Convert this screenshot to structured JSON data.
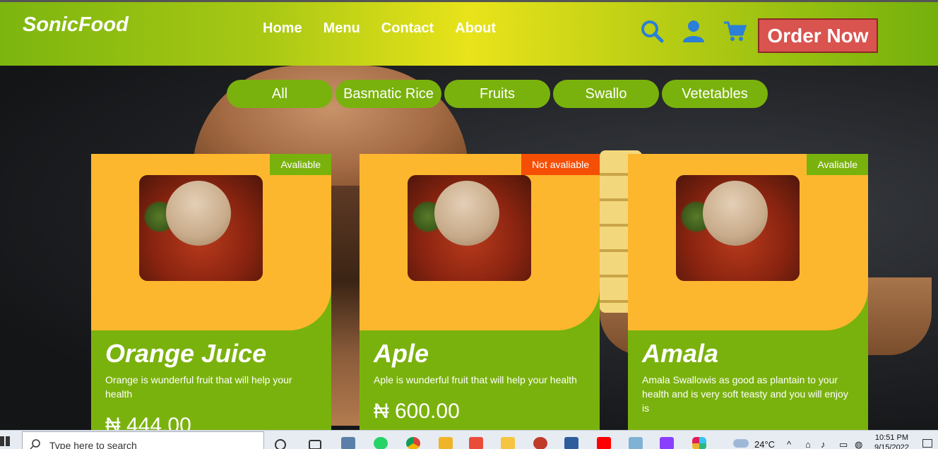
{
  "header": {
    "logo": "SonicFood",
    "nav": [
      "Home",
      "Menu",
      "Contact",
      "About"
    ],
    "icons": [
      "search-icon",
      "user-icon",
      "cart-icon"
    ],
    "order_button": "Order Now"
  },
  "filters": [
    "All",
    "Basmatic Rice",
    "Fruits",
    "Swallo",
    "Vetetables"
  ],
  "cards": [
    {
      "badge": "Avaliable",
      "title": "Orange Juice",
      "description": "Orange is wunderful fruit that will help your health",
      "price": "₦ 444.00"
    },
    {
      "badge": "Not avaliable",
      "title": "Aple",
      "description": "Aple is wunderful fruit that will help your health",
      "price": "₦ 600.00"
    },
    {
      "badge": "Avaliable",
      "title": "Amala",
      "description": "Amala Swallowis as good as plantain to your health and is very soft teasty and you will enjoy is",
      "price": ""
    }
  ],
  "taskbar": {
    "search_placeholder": "Type here to search",
    "weather": "24°C",
    "time": "10:51 PM",
    "date": "9/15/2022"
  },
  "colors": {
    "green": "#7ab20d",
    "card_yellow": "#fcb72e",
    "order_red": "#d9534f",
    "not_available": "#f54f06"
  }
}
